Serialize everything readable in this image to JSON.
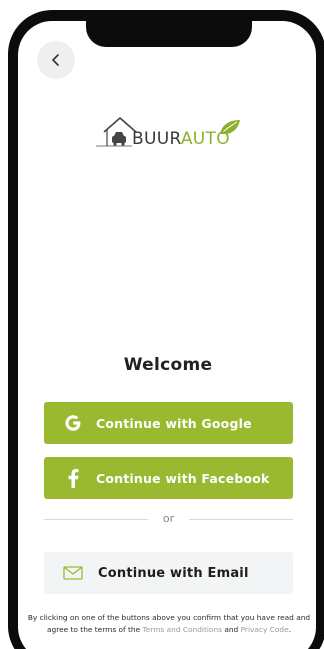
{
  "header": {
    "back_icon": "chevron-left-icon"
  },
  "logo": {
    "text_part1": "BUUR",
    "text_part2": "AUTO",
    "icon": "house-car-leaf-logo",
    "colors": {
      "dark": "#3a3a3a",
      "accent": "#8db12f"
    }
  },
  "main": {
    "title": "Welcome",
    "buttons": {
      "google": {
        "label": "Continue with Google",
        "icon": "google-icon"
      },
      "facebook": {
        "label": "Continue with Facebook",
        "icon": "facebook-icon"
      },
      "email": {
        "label": "Continue with Email",
        "icon": "envelope-icon"
      }
    },
    "divider_text": "or"
  },
  "legal": {
    "prefix": "By clicking on one of the buttons above you confirm that you have read and agree to the terms of the ",
    "terms_link": "Terms and Conditions",
    "and": " and ",
    "privacy_link": "Privacy Code",
    "suffix": "."
  },
  "theme": {
    "accent": "#9ab931",
    "email_button_bg": "#f3f4f5",
    "phone_frame": "#0c0c0c"
  }
}
